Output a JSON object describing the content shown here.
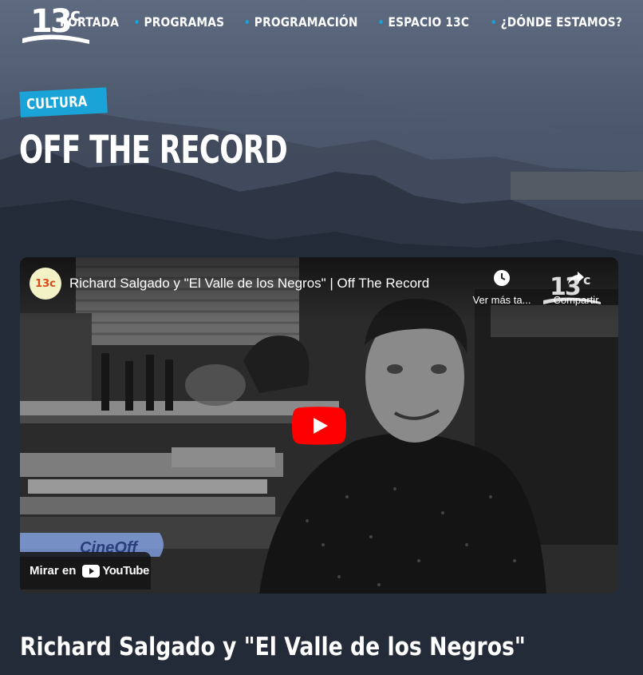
{
  "header": {
    "logo_text": "13c",
    "nav": [
      {
        "label": "PORTADA"
      },
      {
        "label": "PROGRAMAS"
      },
      {
        "label": "PROGRAMACIÓN"
      },
      {
        "label": "ESPACIO 13C"
      },
      {
        "label": "¿DÓNDE ESTAMOS?"
      }
    ]
  },
  "program": {
    "category": "CULTURA",
    "title": "OFF THE RECORD"
  },
  "video": {
    "channel_avatar_text": "13c",
    "title": "Richard Salgado y \"El Valle de los Negros\" | Off The Record",
    "watch_later_label": "Ver más ta...",
    "share_label": "Compartir",
    "watch_on_label": "Mirar en",
    "youtube_word": "YouTube",
    "scene_overlay_text": "CineOff",
    "icons": {
      "watch_later": "clock-icon",
      "share": "share-arrow-icon",
      "play": "play-icon"
    }
  },
  "episode": {
    "title": "Richard Salgado y \"El Valle de los Negros\""
  },
  "colors": {
    "accent": "#1aa3d6",
    "youtube_red": "#ff0000",
    "background": "#1c2330"
  }
}
